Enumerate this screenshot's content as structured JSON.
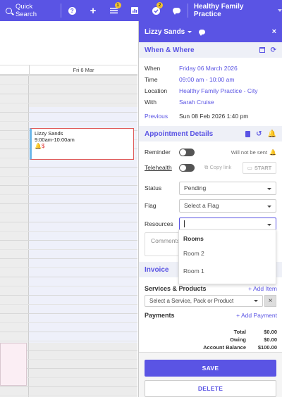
{
  "topbar": {
    "quick_search_label": "Quick Search",
    "help_label": "?",
    "add_label": "+",
    "waitlist_badge": "1",
    "tasks_badge": "2",
    "practice_name": "Healthy Family Practice"
  },
  "calendar": {
    "day_label": "Fri 6 Mar",
    "appointment": {
      "name": "Lizzy Sands",
      "time": "9:00am-10:00am",
      "icons": "🔔$"
    }
  },
  "panel": {
    "patient_name": "Lizzy Sands",
    "close_label": "×",
    "when_where": {
      "title": "When & Where",
      "rows": [
        {
          "label": "When",
          "value": "Friday 06 March 2026"
        },
        {
          "label": "Time",
          "value": "09:00 am - 10:00 am"
        },
        {
          "label": "Location",
          "value": "Healthy Family Practice - City"
        },
        {
          "label": "With",
          "value": "Sarah Cruise"
        }
      ],
      "previous_label": "Previous",
      "previous_value": "Sun 08 Feb 2026 1:40 pm"
    },
    "appointment_details": {
      "title": "Appointment Details",
      "reminder_label": "Reminder",
      "reminder_note": "Will not be sent",
      "telehealth_label": "Telehealth",
      "copy_link_label": "Copy link",
      "start_label": "START",
      "status_label": "Status",
      "status_value": "Pending",
      "flag_label": "Flag",
      "flag_placeholder": "Select a Flag",
      "resources_label": "Resources",
      "comments_placeholder": "Comments"
    },
    "resources_dropdown": {
      "group": "Rooms",
      "options": [
        "Room 2",
        "Room 1"
      ]
    },
    "invoice": {
      "title": "Invoice",
      "services_title": "Services & Products",
      "add_item_label": "+ Add Item",
      "service_placeholder": "Select a Service, Pack or Product",
      "remove_label": "×",
      "payments_title": "Payments",
      "add_payment_label": "+ Add Payment",
      "totals": [
        {
          "label": "Total",
          "value": "$0.00"
        },
        {
          "label": "Owing",
          "value": "$0.00"
        },
        {
          "label": "Account Balance",
          "value": "$100.00"
        }
      ]
    },
    "save_label": "SAVE",
    "delete_label": "DELETE"
  },
  "colors": {
    "brand": "#5a54e4",
    "appointment_border": "#e05b5b",
    "appointment_stripe": "#6cb6e8"
  }
}
